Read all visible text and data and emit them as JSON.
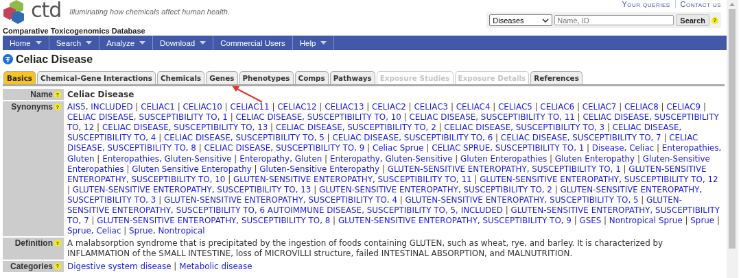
{
  "logo": {
    "text": "ctd",
    "tagline": "Illuminating how chemicals affect human health.",
    "site_name": "Comparative Toxicogenomics Database"
  },
  "top_links": [
    "Your queries",
    "Contact us"
  ],
  "search": {
    "category": "Diseases",
    "placeholder": "Name, ID",
    "button": "Search",
    "help": "?"
  },
  "nav": [
    {
      "label": "Home",
      "has_menu": true
    },
    {
      "label": "Search",
      "has_menu": true
    },
    {
      "label": "Analyze",
      "has_menu": true
    },
    {
      "label": "Download",
      "has_menu": true
    },
    {
      "label": "Commercial Users",
      "has_menu": false
    },
    {
      "label": "Help",
      "has_menu": true
    }
  ],
  "page_title": "Celiac Disease",
  "tabs": [
    {
      "label": "Basics",
      "selected": true,
      "disabled": false
    },
    {
      "label": "Chemical–Gene Interactions",
      "selected": false,
      "disabled": false
    },
    {
      "label": "Chemicals",
      "selected": false,
      "disabled": false
    },
    {
      "label": "Genes",
      "selected": false,
      "disabled": false
    },
    {
      "label": "Phenotypes",
      "selected": false,
      "disabled": false
    },
    {
      "label": "Comps",
      "selected": false,
      "disabled": false
    },
    {
      "label": "Pathways",
      "selected": false,
      "disabled": false
    },
    {
      "label": "Exposure Studies",
      "selected": false,
      "disabled": true
    },
    {
      "label": "Exposure Details",
      "selected": false,
      "disabled": true
    },
    {
      "label": "References",
      "selected": false,
      "disabled": false
    }
  ],
  "separator": "|",
  "fields": [
    {
      "label": "Name",
      "help": "?",
      "kind": "text",
      "bold": true,
      "value": "Celiac Disease"
    },
    {
      "label": "Synonyms",
      "help": "?",
      "kind": "links",
      "links": [
        "AIS5, INCLUDED",
        "CELIAC1",
        "CELIAC10",
        "CELIAC11",
        "CELIAC12",
        "CELIAC13",
        "CELIAC2",
        "CELIAC3",
        "CELIAC4",
        "CELIAC5",
        "CELIAC6",
        "CELIAC7",
        "CELIAC8",
        "CELIAC9",
        "CELIAC DISEASE, SUSCEPTIBILITY TO, 1",
        "CELIAC DISEASE, SUSCEPTIBILITY TO, 10",
        "CELIAC DISEASE, SUSCEPTIBILITY TO, 11",
        "CELIAC DISEASE, SUSCEPTIBILITY TO, 12",
        "CELIAC DISEASE, SUSCEPTIBILITY TO, 13",
        "CELIAC DISEASE, SUSCEPTIBILITY TO, 2",
        "CELIAC DISEASE, SUSCEPTIBILITY TO, 3",
        "CELIAC DISEASE, SUSCEPTIBILITY TO, 4",
        "CELIAC DISEASE, SUSCEPTIBILITY TO, 5",
        "CELIAC DISEASE, SUSCEPTIBILITY TO, 6",
        "CELIAC DISEASE, SUSCEPTIBILITY TO, 7",
        "CELIAC DISEASE, SUSCEPTIBILITY TO, 8",
        "CELIAC DISEASE, SUSCEPTIBILITY TO, 9",
        "Celiac Sprue",
        "CELIAC SPRUE, SUSCEPTIBILITY TO, 1",
        "Disease, Celiac",
        "Enteropathies, Gluten",
        "Enteropathies, Gluten-Sensitive",
        "Enteropathy, Gluten",
        "Enteropathy, Gluten-Sensitive",
        "Gluten Enteropathies",
        "Gluten Enteropathy",
        "Gluten-Sensitive Enteropathies",
        "Gluten Sensitive Enteropathy",
        "Gluten-Sensitive Enteropathy",
        "GLUTEN-SENSITIVE ENTEROPATHY, SUSCEPTIBILITY TO, 1",
        "GLUTEN-SENSITIVE ENTEROPATHY, SUSCEPTIBILITY TO, 10",
        "GLUTEN-SENSITIVE ENTEROPATHY, SUSCEPTIBILITY TO, 11",
        "GLUTEN-SENSITIVE ENTEROPATHY, SUSCEPTIBILITY TO, 12",
        "GLUTEN-SENSITIVE ENTEROPATHY, SUSCEPTIBILITY TO, 13",
        "GLUTEN-SENSITIVE ENTEROPATHY, SUSCEPTIBILITY TO, 2",
        "GLUTEN-SENSITIVE ENTEROPATHY, SUSCEPTIBILITY TO, 3",
        "GLUTEN-SENSITIVE ENTEROPATHY, SUSCEPTIBILITY TO, 4",
        "GLUTEN-SENSITIVE ENTEROPATHY, SUSCEPTIBILITY TO, 5",
        "GLUTEN-SENSITIVE ENTEROPATHY, SUSCEPTIBILITY TO, 6 AUTOIMMUNE DISEASE, SUSCEPTIBILITY TO, 5, INCLUDED",
        "GLUTEN-SENSITIVE ENTEROPATHY, SUSCEPTIBILITY TO, 7",
        "GLUTEN-SENSITIVE ENTEROPATHY, SUSCEPTIBILITY TO, 8",
        "GLUTEN-SENSITIVE ENTEROPATHY, SUSCEPTIBILITY TO, 9",
        "GSES",
        "Nontropical Sprue",
        "Sprue",
        "Sprue, Celiac",
        "Sprue, Nontropical"
      ]
    },
    {
      "label": "Definition",
      "help": "?",
      "kind": "text",
      "bold": false,
      "value": "A malabsorption syndrome that is precipitated by the ingestion of foods containing GLUTEN, such as wheat, rye, and barley. It is characterized by INFLAMMATION of the SMALL INTESTINE, loss of MICROVILLI structure, failed INTESTINAL ABSORPTION, and MALNUTRITION."
    },
    {
      "label": "Categories",
      "help": "?",
      "kind": "links",
      "links": [
        "Digestive system disease",
        "Metabolic disease"
      ]
    }
  ]
}
